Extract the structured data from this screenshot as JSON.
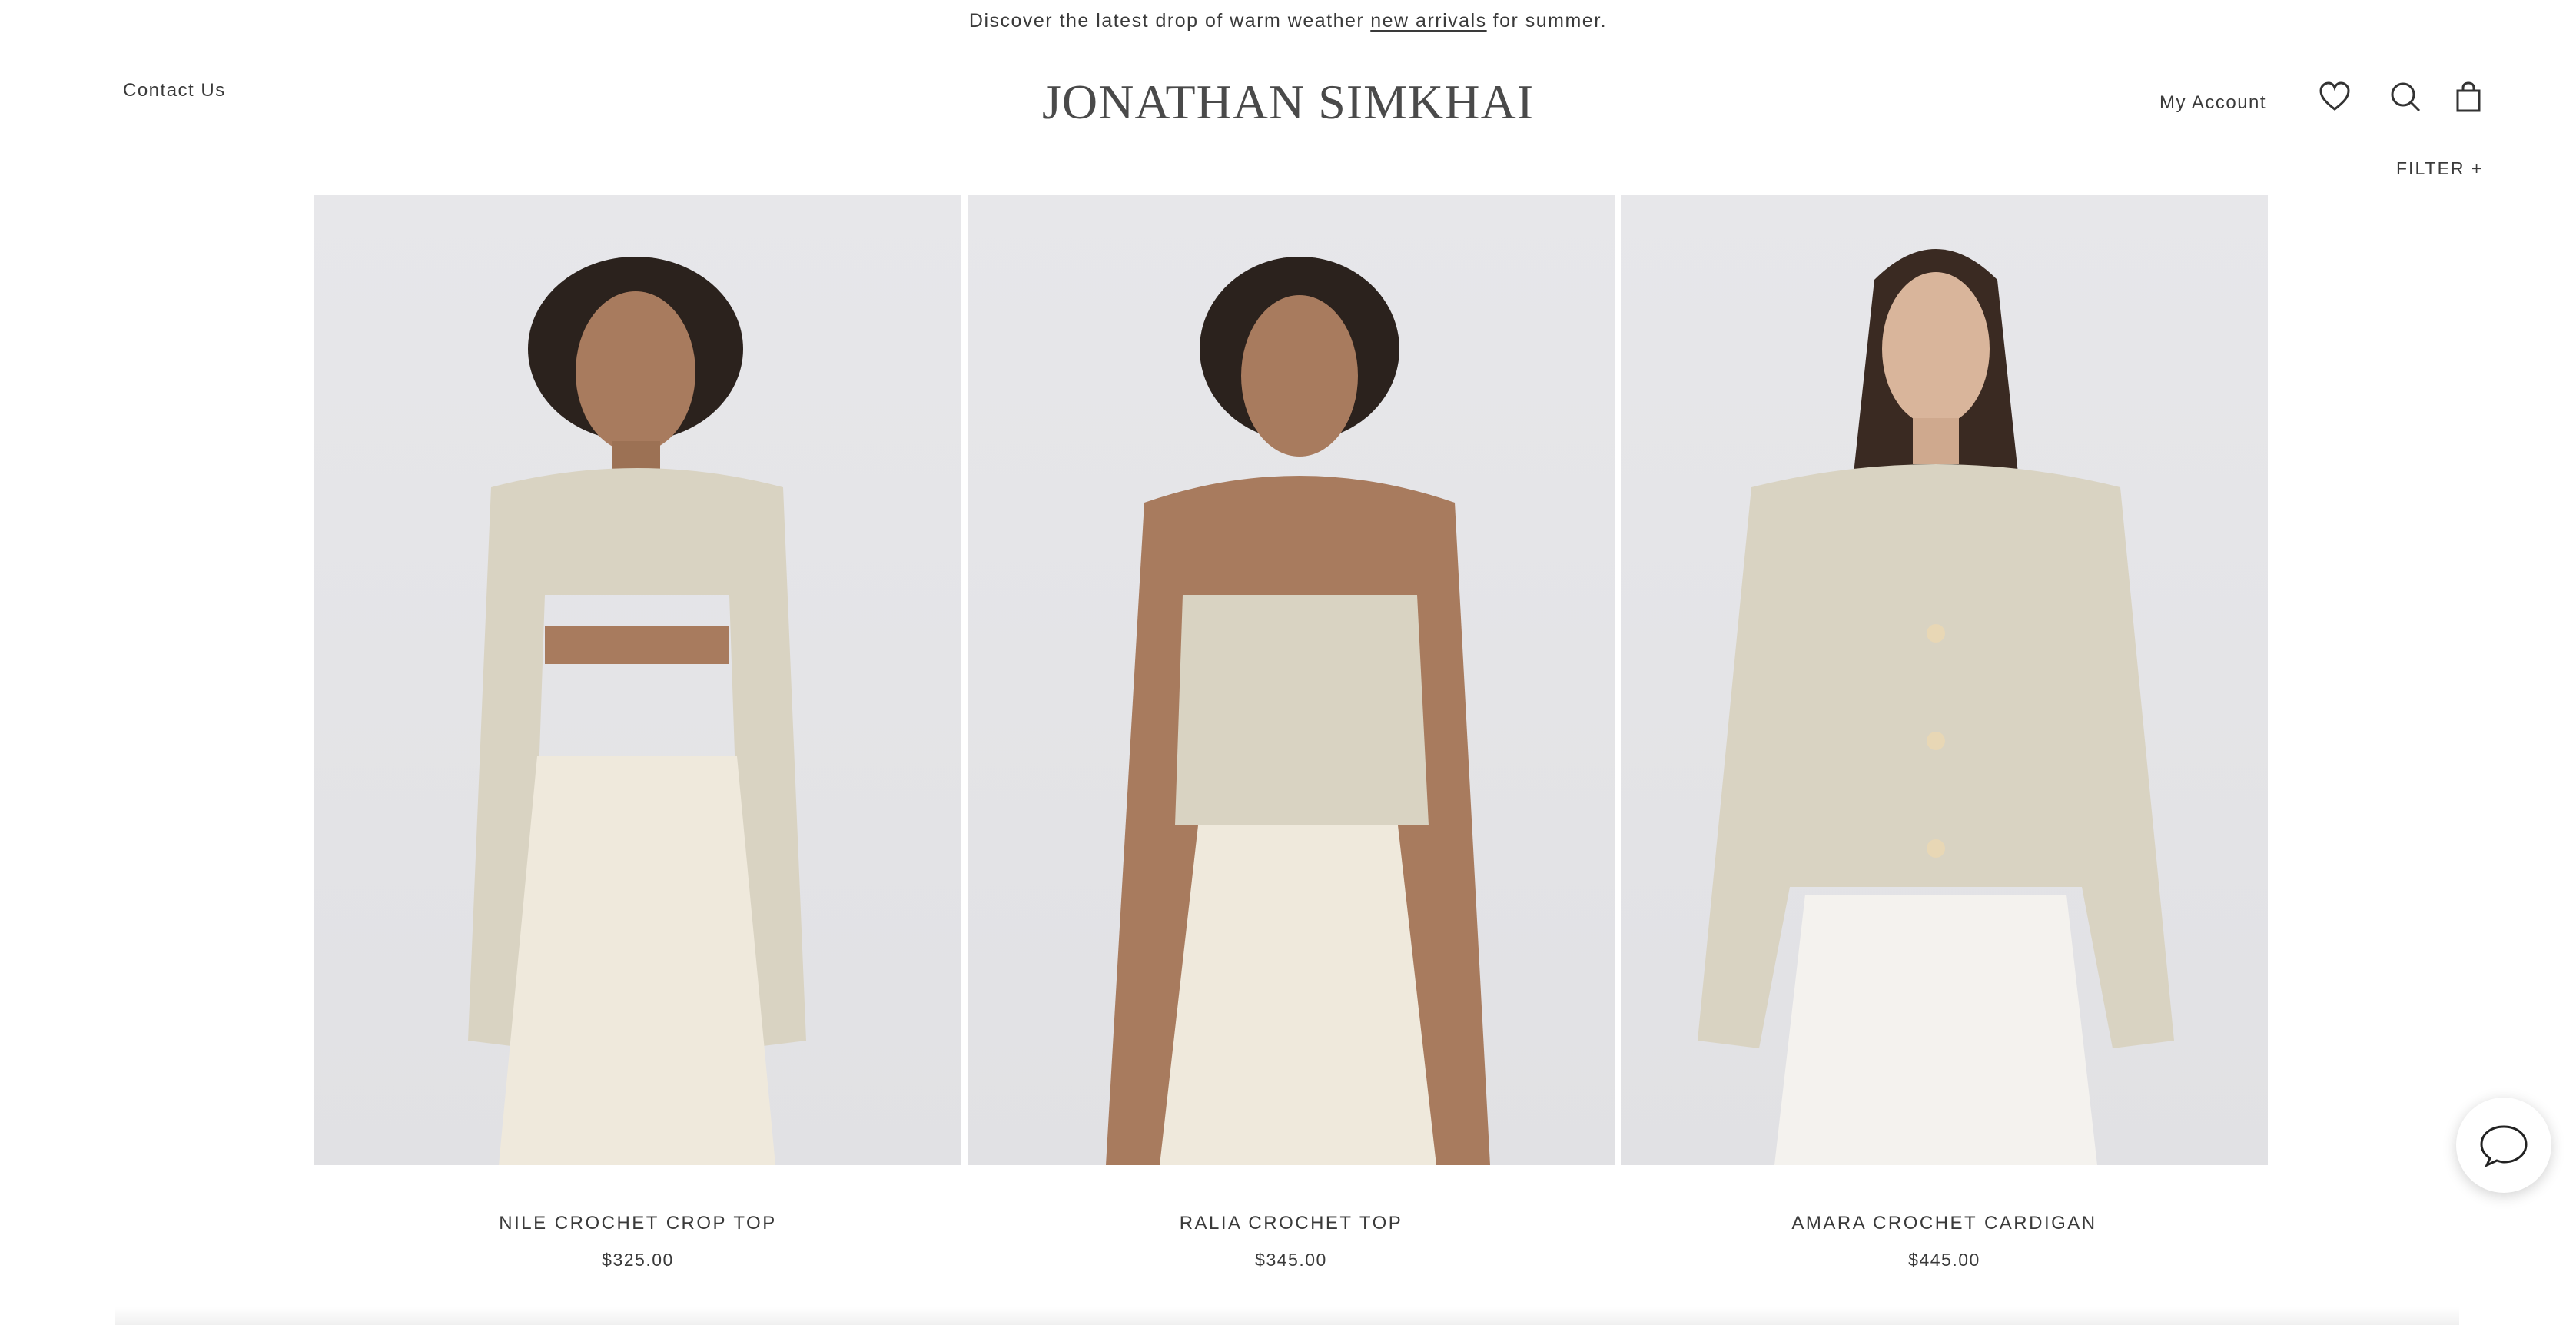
{
  "announcement": {
    "prefix": "Discover the latest drop of warm weather",
    "link": "new arrivals",
    "suffix": "for summer."
  },
  "header": {
    "contact_label": "Contact Us",
    "logo": "JONATHAN SIMKHAI",
    "account_label": "My Account",
    "icons": [
      "heart-icon",
      "search-icon",
      "shopping-bag-icon"
    ]
  },
  "filter": {
    "label": "FILTER +"
  },
  "products": [
    {
      "name": "NILE CROCHET CROP TOP",
      "price": "$325.00"
    },
    {
      "name": "RALIA CROCHET TOP",
      "price": "$345.00"
    },
    {
      "name": "AMARA CROCHET CARDIGAN",
      "price": "$445.00"
    }
  ],
  "chat": {
    "icon": "chat-bubble-icon"
  },
  "colors": {
    "text": "#3a3a3a",
    "background": "#ffffff",
    "photo_bg": "#e4e4e7",
    "garment": "#d9d3c2",
    "trousers": "#efe9dc"
  }
}
